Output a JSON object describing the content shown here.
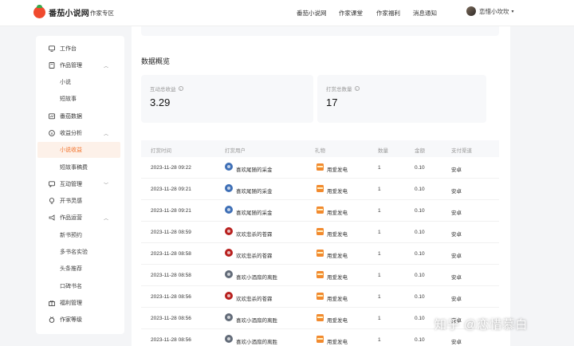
{
  "header": {
    "logo_text": "番茄小说网",
    "zone": "作家专区",
    "nav": [
      "番茄小说网",
      "作家课堂",
      "作家福利",
      "消息通知"
    ],
    "username": "恋惜小坎坎"
  },
  "sidebar": {
    "items": [
      {
        "label": "工作台",
        "icon": "monitor-icon"
      },
      {
        "label": "作品管理",
        "icon": "book-icon",
        "expanded": true
      },
      {
        "label": "小说"
      },
      {
        "label": "短故事"
      },
      {
        "label": "番茄数据",
        "icon": "chart-icon"
      },
      {
        "label": "收益分析",
        "icon": "coin-icon",
        "expanded": true
      },
      {
        "label": "小说收益",
        "active": true
      },
      {
        "label": "短故事稿费"
      },
      {
        "label": "互动管理",
        "icon": "chat-icon",
        "expanded": false
      },
      {
        "label": "开书灵感",
        "icon": "lightbulb-icon"
      },
      {
        "label": "作品运营",
        "icon": "megaphone-icon",
        "expanded": true
      },
      {
        "label": "新书预约"
      },
      {
        "label": "多书名实验"
      },
      {
        "label": "头条推荐"
      },
      {
        "label": "口碑书名"
      },
      {
        "label": "福利管理",
        "icon": "gift-icon"
      },
      {
        "label": "作家等级",
        "icon": "medal-icon"
      }
    ]
  },
  "overview": {
    "title": "数据概览",
    "stats": [
      {
        "label": "互动总收益",
        "value": "3.29"
      },
      {
        "label": "打赏总数量",
        "value": "17"
      }
    ]
  },
  "table": {
    "columns": [
      "打赏时间",
      "打赏用户",
      "礼物",
      "数量",
      "金额",
      "支付渠道"
    ],
    "rows": [
      {
        "time": "2023-11-28 09:22",
        "user": "喜欢尾随的采金",
        "avatar": "blue",
        "gift": "用爱发电",
        "qty": "1",
        "amount": "0.10",
        "channel": "安卓"
      },
      {
        "time": "2023-11-28 09:21",
        "user": "喜欢尾随的采金",
        "avatar": "blue",
        "gift": "用爱发电",
        "qty": "1",
        "amount": "0.10",
        "channel": "安卓"
      },
      {
        "time": "2023-11-28 09:21",
        "user": "喜欢尾随的采金",
        "avatar": "blue",
        "gift": "用爱发电",
        "qty": "1",
        "amount": "0.10",
        "channel": "安卓"
      },
      {
        "time": "2023-11-28 08:59",
        "user": "欢欢悲杀的苍霖",
        "avatar": "red",
        "gift": "用爱发电",
        "qty": "1",
        "amount": "0.10",
        "channel": "安卓"
      },
      {
        "time": "2023-11-28 08:58",
        "user": "欢欢悲杀的苍霖",
        "avatar": "red",
        "gift": "用爱发电",
        "qty": "1",
        "amount": "0.10",
        "channel": "安卓"
      },
      {
        "time": "2023-11-28 08:58",
        "user": "喜欢小酒扇的离胜",
        "avatar": "gray",
        "gift": "用爱发电",
        "qty": "1",
        "amount": "0.10",
        "channel": "安卓"
      },
      {
        "time": "2023-11-28 08:56",
        "user": "欢欢悲杀的苍霖",
        "avatar": "red",
        "gift": "用爱发电",
        "qty": "1",
        "amount": "0.10",
        "channel": "安卓"
      },
      {
        "time": "2023-11-28 08:56",
        "user": "喜欢小酒扇的离胜",
        "avatar": "gray",
        "gift": "用爱发电",
        "qty": "1",
        "amount": "0.10",
        "channel": "安卓"
      },
      {
        "time": "2023-11-28 08:56",
        "user": "喜欢小酒扇的离胜",
        "avatar": "gray",
        "gift": "用爱发电",
        "qty": "1",
        "amount": "0.10",
        "channel": "安卓"
      }
    ]
  },
  "watermark": "知乎 @恋惜慕白"
}
